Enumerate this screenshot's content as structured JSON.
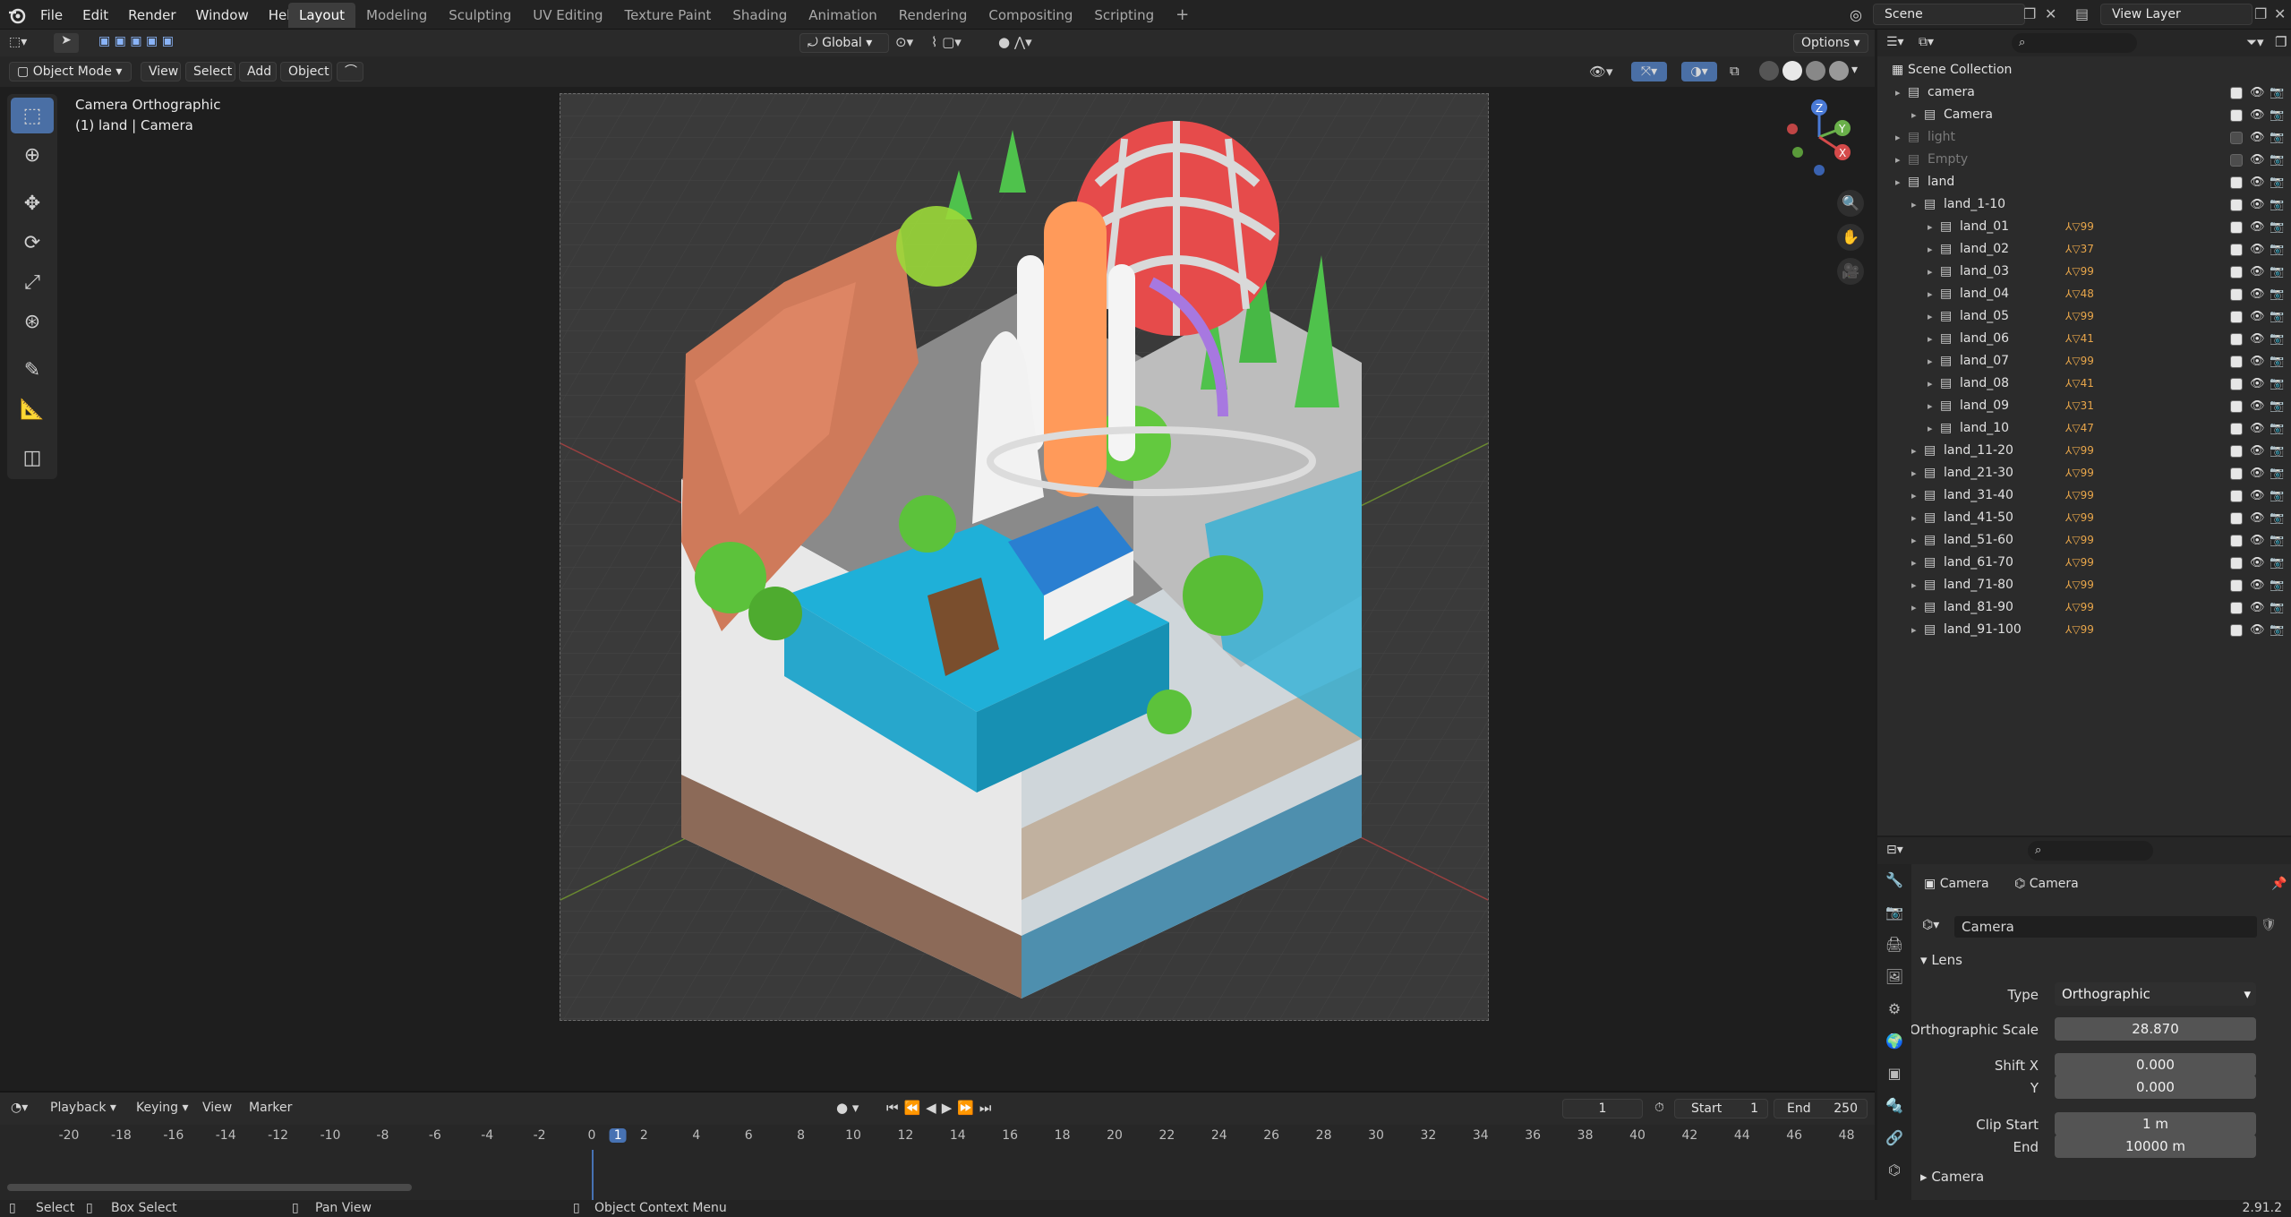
{
  "app": {
    "name": "Blender",
    "version": "2.91.2"
  },
  "menu": [
    "File",
    "Edit",
    "Render",
    "Window",
    "Help"
  ],
  "workspaces": {
    "active": "Layout",
    "tabs": [
      "Layout",
      "Modeling",
      "Sculpting",
      "UV Editing",
      "Texture Paint",
      "Shading",
      "Animation",
      "Rendering",
      "Compositing",
      "Scripting"
    ]
  },
  "header_right": {
    "scene": "Scene",
    "view_layer": "View Layer"
  },
  "viewport": {
    "mode": "Object Mode",
    "menus": [
      "View",
      "Select",
      "Add",
      "Object"
    ],
    "orientation": "Global",
    "options_label": "Options",
    "overlay_line1": "Camera Orthographic",
    "overlay_line2": "(1) land | Camera",
    "gizmo_axes": [
      "Z",
      "Y",
      "X"
    ]
  },
  "tools": [
    "select-box",
    "cursor",
    "move",
    "rotate",
    "scale",
    "transform",
    "annotate",
    "measure",
    "add-cube"
  ],
  "timeline": {
    "menus": [
      "Playback",
      "Keying",
      "View",
      "Marker"
    ],
    "current_frame": "1",
    "start_label": "Start",
    "start_value": "1",
    "end_label": "End",
    "end_value": "250",
    "ruler": [
      "-20",
      "-18",
      "-16",
      "-14",
      "-12",
      "-10",
      "-8",
      "-6",
      "-4",
      "-2",
      "0",
      "1",
      "2",
      "4",
      "6",
      "8",
      "10",
      "12",
      "14",
      "16",
      "18",
      "20",
      "22",
      "24",
      "26",
      "28",
      "30",
      "32",
      "34",
      "36",
      "38",
      "40",
      "42",
      "44",
      "46",
      "48"
    ]
  },
  "statusbar": {
    "select": "Select",
    "box_select": "Box Select",
    "pan_view": "Pan View",
    "context_menu": "Object Context Menu",
    "version": "2.91.2"
  },
  "outliner": {
    "root": "Scene Collection",
    "rows": [
      {
        "label": "camera",
        "indent": 1,
        "dim": false
      },
      {
        "label": "Camera",
        "indent": 2,
        "dim": false
      },
      {
        "label": "light",
        "indent": 1,
        "dim": true
      },
      {
        "label": "Empty",
        "indent": 1,
        "dim": true
      },
      {
        "label": "land",
        "indent": 1,
        "dim": false
      },
      {
        "label": "land_1-10",
        "indent": 2,
        "dim": false
      },
      {
        "label": "land_01",
        "indent": 3,
        "dim": false,
        "badge": "99"
      },
      {
        "label": "land_02",
        "indent": 3,
        "dim": false,
        "badge": "37"
      },
      {
        "label": "land_03",
        "indent": 3,
        "dim": false,
        "badge": "99"
      },
      {
        "label": "land_04",
        "indent": 3,
        "dim": false,
        "badge": "48"
      },
      {
        "label": "land_05",
        "indent": 3,
        "dim": false,
        "badge": "99"
      },
      {
        "label": "land_06",
        "indent": 3,
        "dim": false,
        "badge": "41"
      },
      {
        "label": "land_07",
        "indent": 3,
        "dim": false,
        "badge": "99"
      },
      {
        "label": "land_08",
        "indent": 3,
        "dim": false,
        "badge": "41"
      },
      {
        "label": "land_09",
        "indent": 3,
        "dim": false,
        "badge": "31"
      },
      {
        "label": "land_10",
        "indent": 3,
        "dim": false,
        "badge": "47"
      },
      {
        "label": "land_11-20",
        "indent": 2,
        "dim": false,
        "badge": "99"
      },
      {
        "label": "land_21-30",
        "indent": 2,
        "dim": false,
        "badge": "99"
      },
      {
        "label": "land_31-40",
        "indent": 2,
        "dim": false,
        "badge": "99"
      },
      {
        "label": "land_41-50",
        "indent": 2,
        "dim": false,
        "badge": "99"
      },
      {
        "label": "land_51-60",
        "indent": 2,
        "dim": false,
        "badge": "99"
      },
      {
        "label": "land_61-70",
        "indent": 2,
        "dim": false,
        "badge": "99"
      },
      {
        "label": "land_71-80",
        "indent": 2,
        "dim": false,
        "badge": "99"
      },
      {
        "label": "land_81-90",
        "indent": 2,
        "dim": false,
        "badge": "99"
      },
      {
        "label": "land_91-100",
        "indent": 2,
        "dim": false,
        "badge": "99"
      }
    ]
  },
  "properties": {
    "breadcrumb_object": "Camera",
    "breadcrumb_data": "Camera",
    "datablock": "Camera",
    "lens_panel": "Lens",
    "type_label": "Type",
    "type_value": "Orthographic",
    "ortho_scale_label": "Orthographic Scale",
    "ortho_scale_value": "28.870",
    "shift_x_label": "Shift X",
    "shift_x_value": "0.000",
    "shift_y_label": "Y",
    "shift_y_value": "0.000",
    "clip_start_label": "Clip Start",
    "clip_start_value": "1 m",
    "clip_end_label": "End",
    "clip_end_value": "10000 m",
    "camera_panel": "Camera"
  },
  "colors": {
    "accent": "#4a6fa5",
    "frame_marker": "#4772b3",
    "balloon_red": "#e64b4b",
    "water": "#1fb0d8",
    "terracotta": "#cf7a5a",
    "foliage": "#5cc23b"
  }
}
